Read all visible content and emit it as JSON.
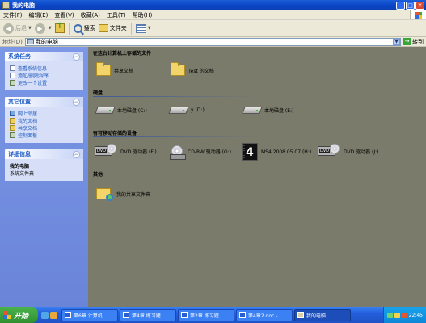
{
  "window": {
    "title": "我的电脑"
  },
  "menu": [
    "文件(F)",
    "编辑(E)",
    "查看(V)",
    "收藏(A)",
    "工具(T)",
    "帮助(H)"
  ],
  "toolbar": {
    "back": "后退",
    "search": "搜索",
    "folders": "文件夹"
  },
  "address": {
    "label": "地址(D)",
    "value": "我的电脑",
    "go": "转到"
  },
  "sidebar": {
    "system_tasks": {
      "title": "系统任务",
      "items": [
        "查看系统信息",
        "添加/删除程序",
        "更改一个设置"
      ]
    },
    "other_places": {
      "title": "其它位置",
      "items": [
        "网上邻居",
        "我的文档",
        "共享文档",
        "控制面板"
      ]
    },
    "details": {
      "title": "详细信息",
      "name": "我的电脑",
      "type": "系统文件夹"
    }
  },
  "sections": {
    "stored_files": "在这台计算机上存储的文件",
    "hard_disks": "硬盘",
    "removable": "有可移动存储的设备",
    "other": "其他"
  },
  "items": {
    "shared_docs": "共享文档",
    "test_docs": "Test 的文档",
    "drive_c": "本地磁盘 (C:)",
    "drive_d": "y (D:)",
    "drive_e": "本地磁盘 (E:)",
    "drive_f": "DVD 驱动器 (F:)",
    "drive_g": "CD-RW 驱动器 (G:)",
    "drive_h": "MS4 2008.05.07 (H:)",
    "drive_j": "DVD 驱动器 (J:)",
    "my_shared": "我的共享文件夹"
  },
  "taskbar": {
    "start": "开始",
    "tasks": [
      "第6章 计算机",
      "第4章 练习题",
      "第2章 练习题",
      "第4章2.doc -",
      "我的电脑"
    ],
    "clock": "22:45"
  },
  "colors": {
    "title_blue": "#0a46c6",
    "sidebar_blue": "#7b97e6",
    "main_bg": "#7b7b6b",
    "taskbar_blue": "#245edb"
  }
}
